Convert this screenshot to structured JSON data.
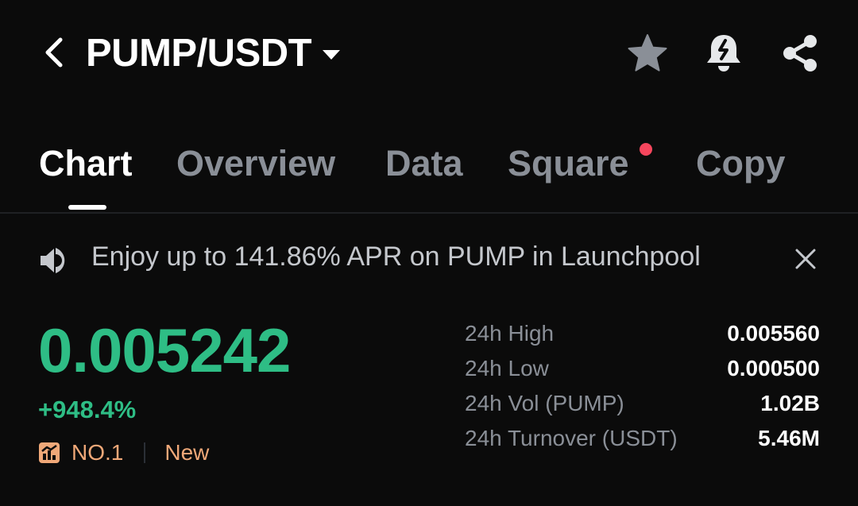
{
  "header": {
    "pair": "PUMP/USDT",
    "icons": [
      "back-arrow-icon",
      "caret-down-icon",
      "star-icon",
      "bell-alert-icon",
      "share-icon"
    ]
  },
  "tabs": [
    {
      "label": "Chart",
      "active": true
    },
    {
      "label": "Overview",
      "active": false
    },
    {
      "label": "Data",
      "active": false
    },
    {
      "label": "Square",
      "active": false,
      "badge_dot": true
    },
    {
      "label": "Copy",
      "active": false
    }
  ],
  "banner": {
    "text": "Enjoy up to 141.86% APR on PUMP in Launchpool",
    "icons": [
      "speaker-icon",
      "close-icon"
    ]
  },
  "ticker": {
    "price": "0.005242",
    "change": "+948.4%",
    "rank": "NO.1",
    "tag": "New"
  },
  "stats": [
    {
      "label": "24h High",
      "value": "0.005560"
    },
    {
      "label": "24h Low",
      "value": "0.000500"
    },
    {
      "label": "24h Vol (PUMP)",
      "value": "1.02B"
    },
    {
      "label": "24h Turnover (USDT)",
      "value": "5.46M"
    }
  ],
  "colors": {
    "background": "#0b0b0b",
    "up_green": "#2ebd85",
    "muted": "#8a8f97",
    "accent_orange": "#f0a878",
    "notification_red": "#f6465d"
  }
}
